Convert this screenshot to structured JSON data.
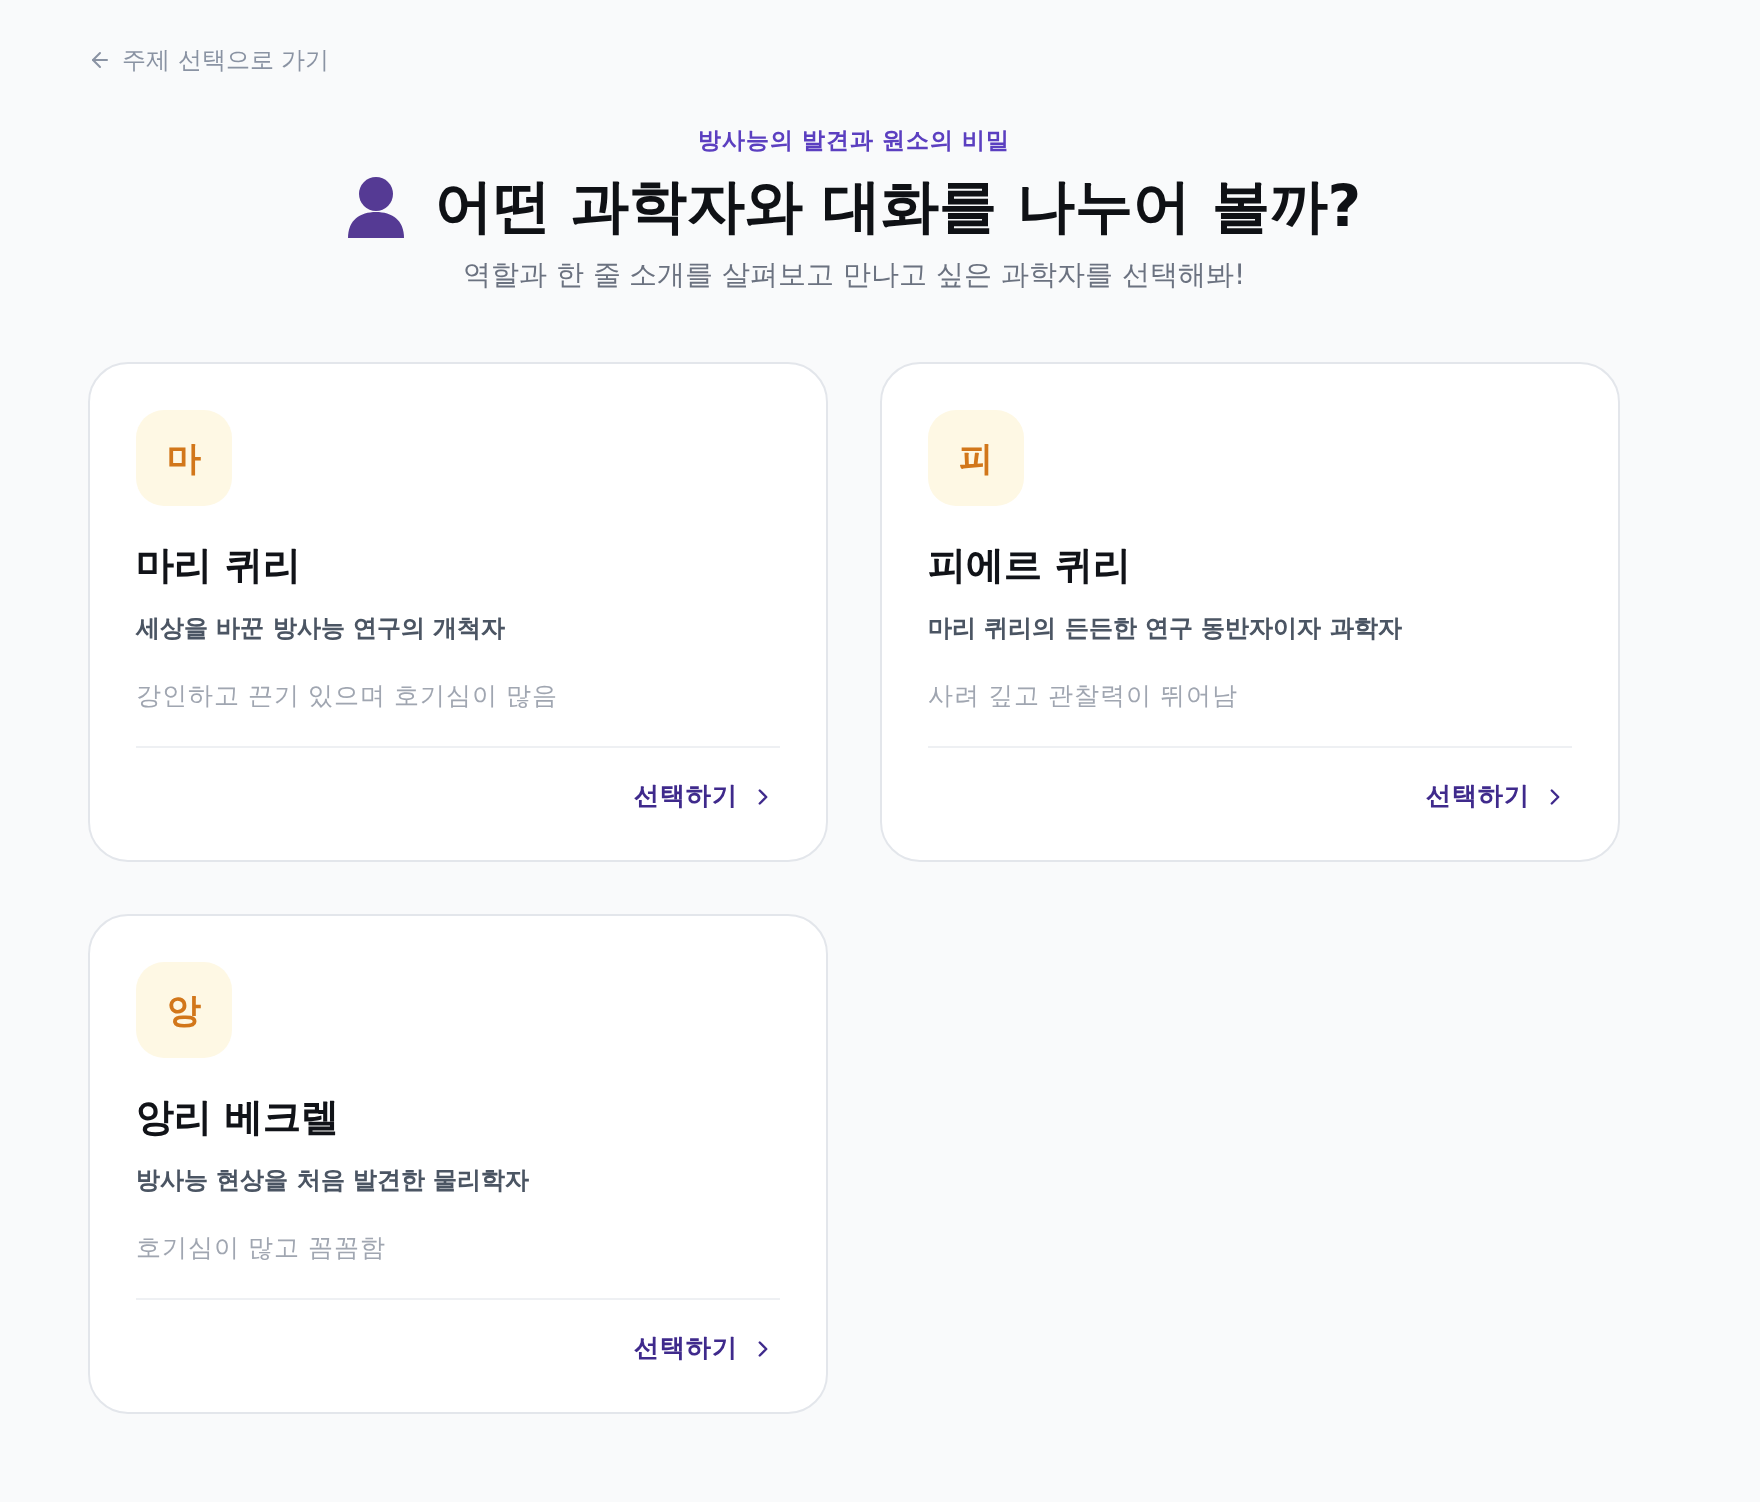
{
  "back_link": {
    "label": "주제 선택으로 가기"
  },
  "header": {
    "topic": "방사능의 발견과 원소의 비밀",
    "title": "어떤 과학자와 대화를 나누어 볼까?",
    "description": "역할과 한 줄 소개를 살펴보고 만나고 싶은 과학자를 선택해봐!"
  },
  "scientists": [
    {
      "initial": "마",
      "name": "마리 퀴리",
      "role": "세상을 바꾼 방사능 연구의 개척자",
      "traits": "강인하고 끈기 있으며 호기심이 많음",
      "action": "선택하기"
    },
    {
      "initial": "피",
      "name": "피에르 퀴리",
      "role": "마리 퀴리의 든든한 연구 동반자이자 과학자",
      "traits": "사려 깊고 관찰력이 뛰어남",
      "action": "선택하기"
    },
    {
      "initial": "앙",
      "name": "앙리 베크렐",
      "role": "방사능 현상을 처음 발견한 물리학자",
      "traits": "호기심이 많고 꼼꼼함",
      "action": "선택하기"
    }
  ]
}
